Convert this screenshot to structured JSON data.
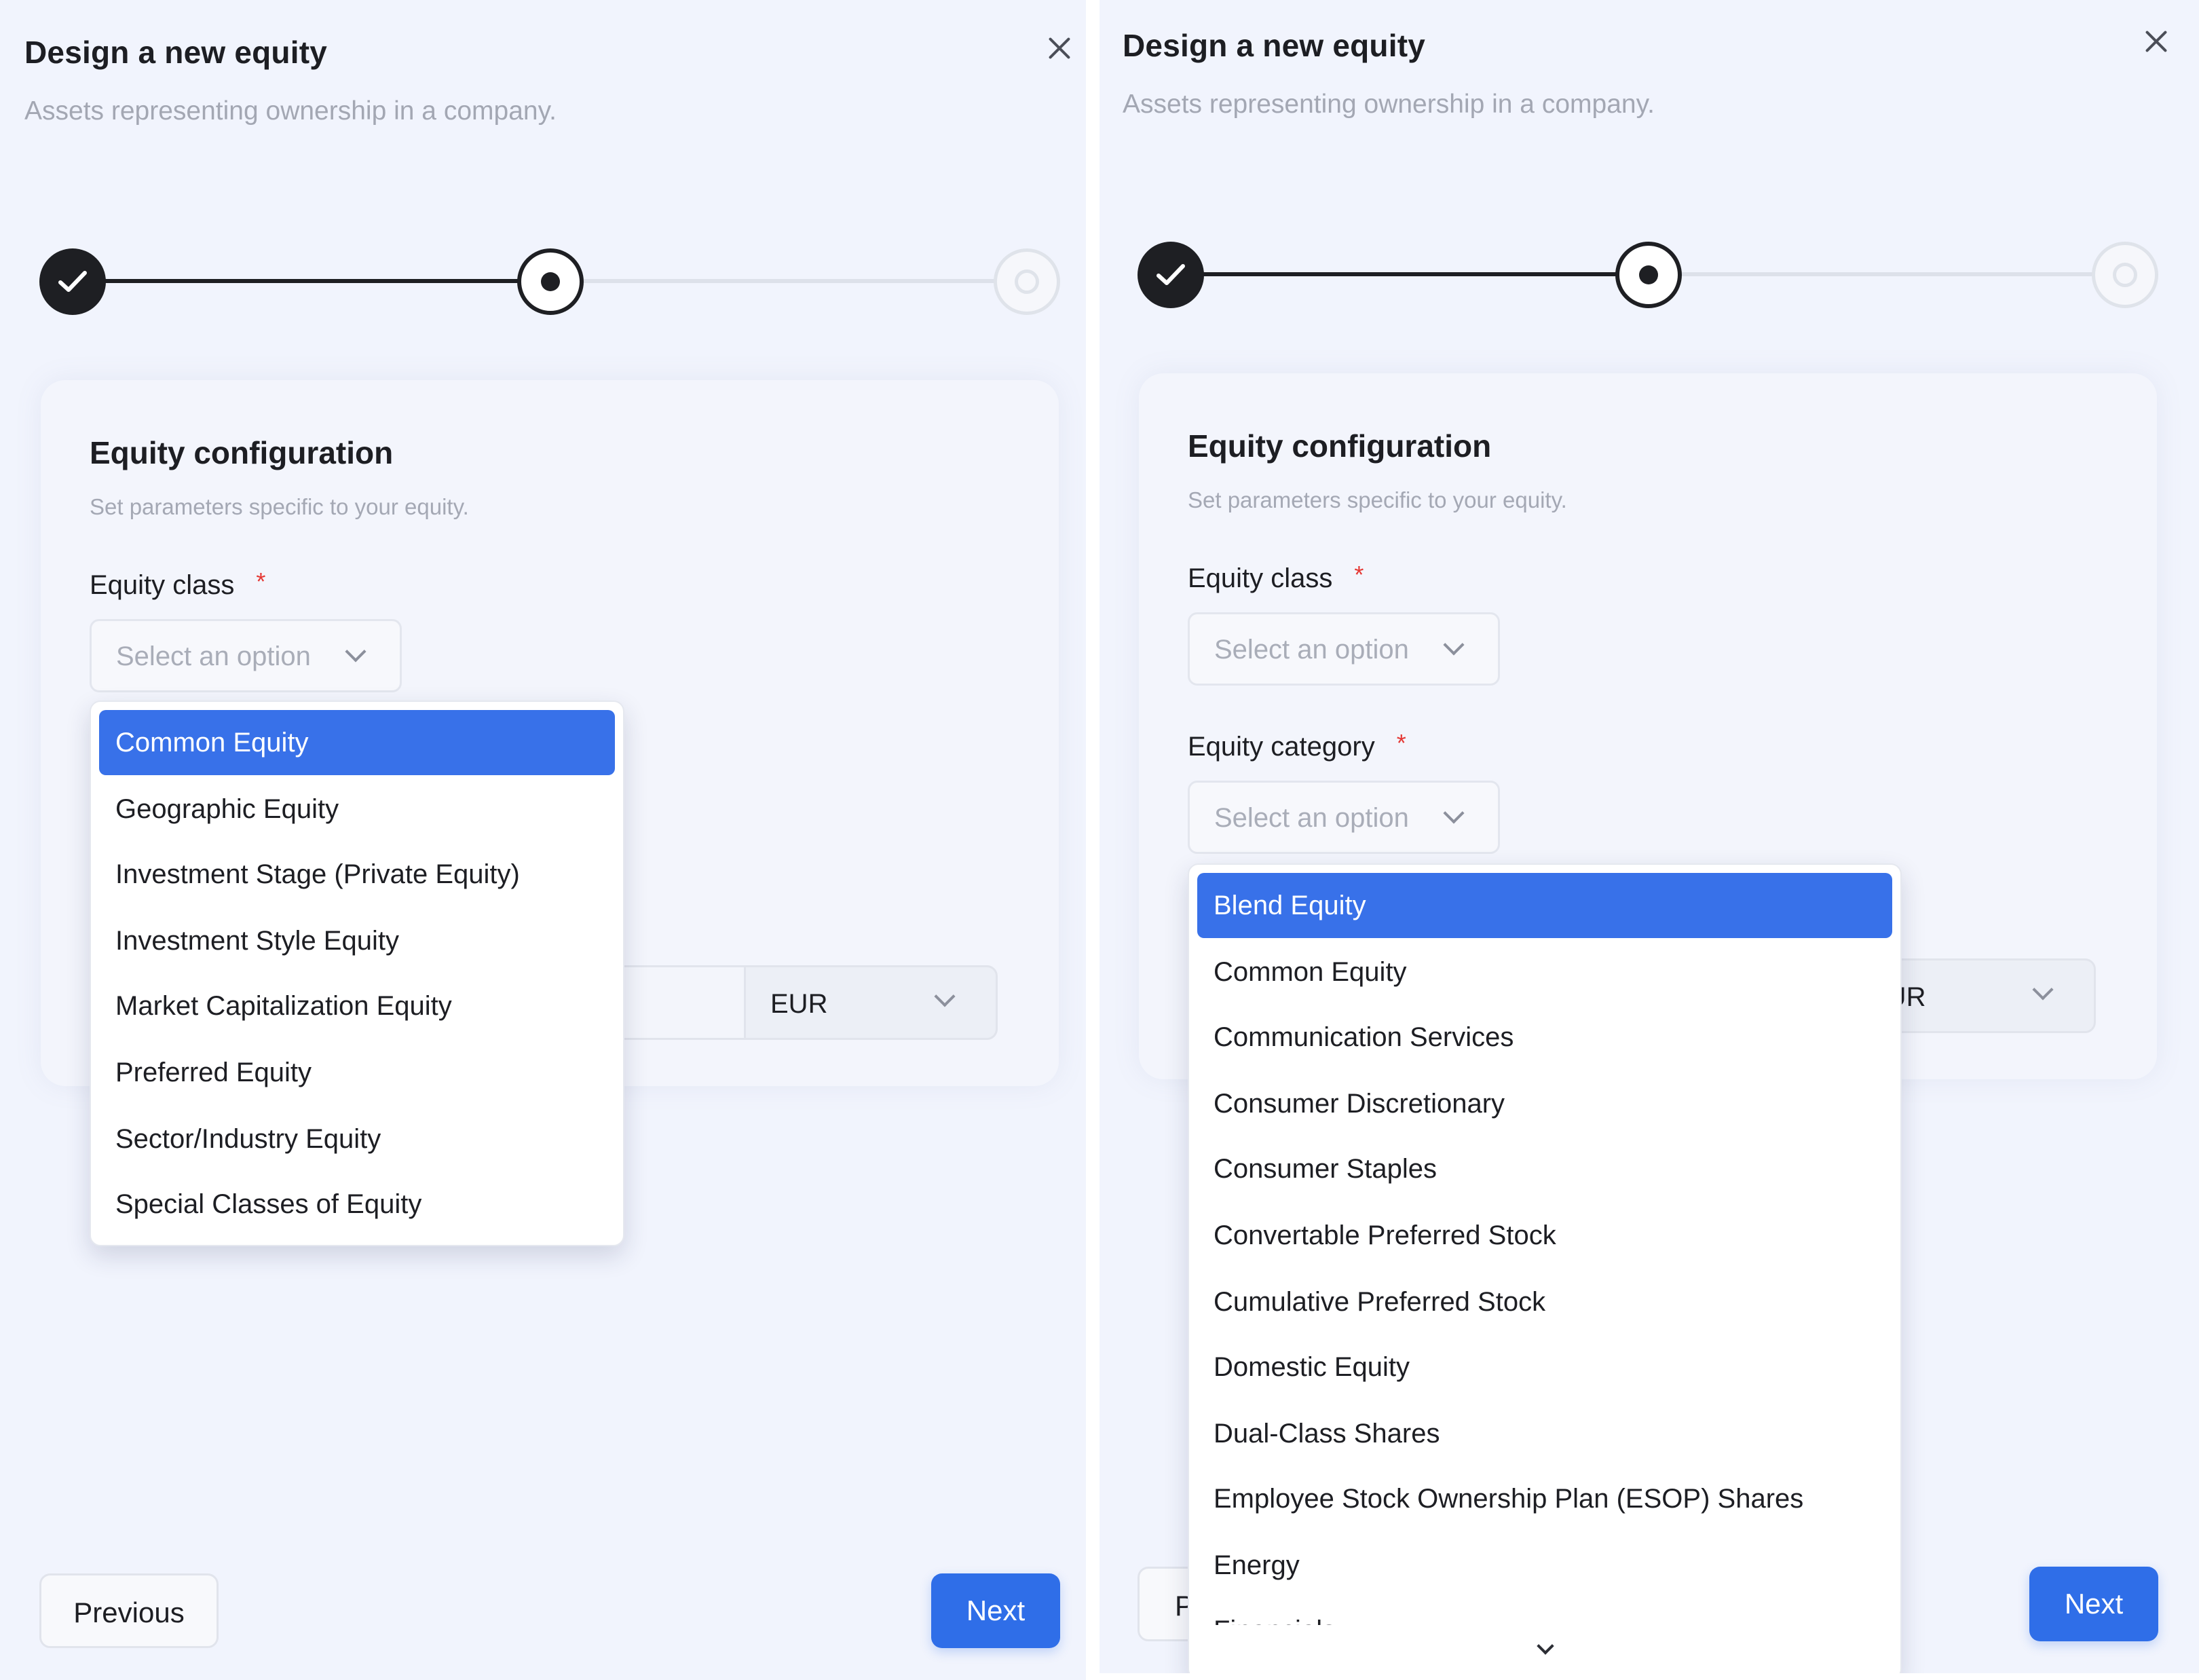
{
  "left": {
    "dialog": {
      "title": "Design a new equity",
      "subtitle": "Assets representing ownership in a company."
    },
    "stepper": {
      "steps": [
        "complete",
        "current",
        "upcoming"
      ]
    },
    "card": {
      "title": "Equity configuration",
      "subtitle": "Set parameters specific to your equity.",
      "equity_class": {
        "label": "Equity class",
        "required_mark": "*",
        "placeholder": "Select an option"
      },
      "currency": {
        "value": "EUR"
      }
    },
    "dropdown": {
      "options": [
        "Common Equity",
        "Geographic Equity",
        "Investment Stage (Private Equity)",
        "Investment Style Equity",
        "Market Capitalization Equity",
        "Preferred Equity",
        "Sector/Industry Equity",
        "Special Classes of Equity"
      ],
      "highlighted": "Common Equity"
    },
    "footer": {
      "previous_label": "Previous",
      "next_label": "Next"
    }
  },
  "right": {
    "dialog": {
      "title": "Design a new equity",
      "subtitle": "Assets representing ownership in a company."
    },
    "stepper": {
      "steps": [
        "complete",
        "current",
        "upcoming"
      ]
    },
    "card": {
      "title": "Equity configuration",
      "subtitle": "Set parameters specific to your equity.",
      "equity_class": {
        "label": "Equity class",
        "required_mark": "*",
        "placeholder": "Select an option"
      },
      "equity_category": {
        "label": "Equity category",
        "required_mark": "*",
        "placeholder": "Select an option"
      },
      "currency": {
        "value": "EUR"
      }
    },
    "dropdown": {
      "options": [
        "Blend Equity",
        "Common Equity",
        "Communication Services",
        "Consumer Discretionary",
        "Consumer Staples",
        "Convertable Preferred Stock",
        "Cumulative Preferred Stock",
        "Domestic Equity",
        "Dual-Class Shares",
        "Employee Stock Ownership Plan (ESOP) Shares",
        "Energy",
        "Financials"
      ],
      "highlighted": "Blend Equity"
    },
    "footer": {
      "previous_label": "P",
      "next_label": "Next"
    }
  },
  "colors": {
    "accent": "#2f6ee8",
    "highlight": "#3871e9",
    "background": "#f1f4fd",
    "required": "#e53935"
  },
  "icons": [
    "close-icon",
    "check-icon",
    "chevron-down-icon"
  ]
}
